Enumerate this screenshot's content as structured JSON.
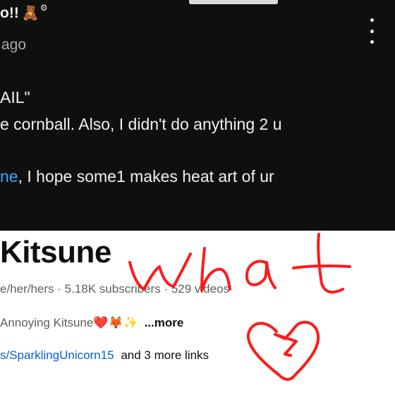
{
  "comment": {
    "author": "o!!",
    "author_emoji": "🧸",
    "author_badge_icon": "gear-icon",
    "time": "ago",
    "line1": "AIL\"",
    "line2": "e cornball. Also, I didn't do anything 2 u",
    "line3_mention": "ne",
    "line3_rest": ", I hope some1 makes heat art of ur",
    "menu_icon": "kebab-menu-icon"
  },
  "channel": {
    "name": "Kitsune",
    "meta": "e/her/hers · 5.18K subscribers · 529 videos",
    "description": "Annoying Kitsune❤️🦊✨",
    "more_label": "...more",
    "link": "s/SparklingUnicorn15",
    "more_links": "and 3 more links"
  },
  "annotation": {
    "text": "what",
    "icon": "broken-heart-icon",
    "color": "#ff1a1a"
  },
  "colors": {
    "dark_bg": "#0f0f0f",
    "mention": "#3ea6ff",
    "link": "#065fd4",
    "meta_text": "#606060"
  }
}
